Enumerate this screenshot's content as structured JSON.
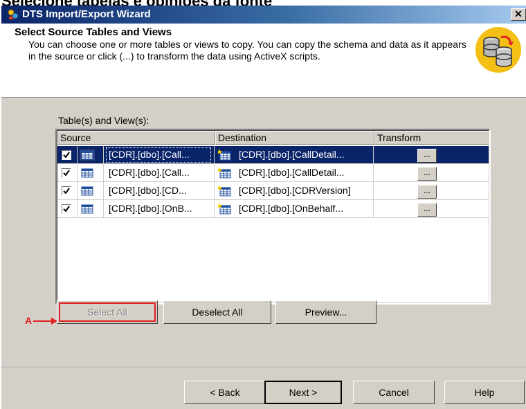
{
  "page_heading": "Selecione tabelas e opiniões da fonte",
  "window": {
    "title": "DTS Import/Export Wizard",
    "close_label": "✕"
  },
  "header": {
    "title": "Select Source Tables and Views",
    "description": "You can choose one or more tables or views to copy.  You can copy the schema and data as it appears in the source or click (...) to transform the data using ActiveX scripts."
  },
  "list": {
    "label": "Table(s) and View(s):",
    "columns": [
      "Source",
      "Destination",
      "Transform"
    ],
    "rows": [
      {
        "checked": true,
        "source": "[CDR].[dbo].[Call...",
        "destination": "[CDR].[dbo].[CallDetail...",
        "transform": "...",
        "selected": true
      },
      {
        "checked": true,
        "source": "[CDR].[dbo].[Call...",
        "destination": "[CDR].[dbo].[CallDetail...",
        "transform": "...",
        "selected": false
      },
      {
        "checked": true,
        "source": "[CDR].[dbo].[CD...",
        "destination": "[CDR].[dbo].[CDRVersion]",
        "transform": "...",
        "selected": false
      },
      {
        "checked": true,
        "source": "[CDR].[dbo].[OnB...",
        "destination": "[CDR].[dbo].[OnBehalf...",
        "transform": "...",
        "selected": false
      }
    ]
  },
  "actions": {
    "select_all": "Select All",
    "deselect_all": "Deselect All",
    "preview": "Preview..."
  },
  "annotation": {
    "label": "A",
    "color": "#e02020"
  },
  "footer": {
    "back": "< Back",
    "next": "Next >",
    "cancel": "Cancel",
    "help": "Help"
  },
  "colors": {
    "selection": "#0a246a",
    "dialog_bg": "#d4d0c8"
  }
}
